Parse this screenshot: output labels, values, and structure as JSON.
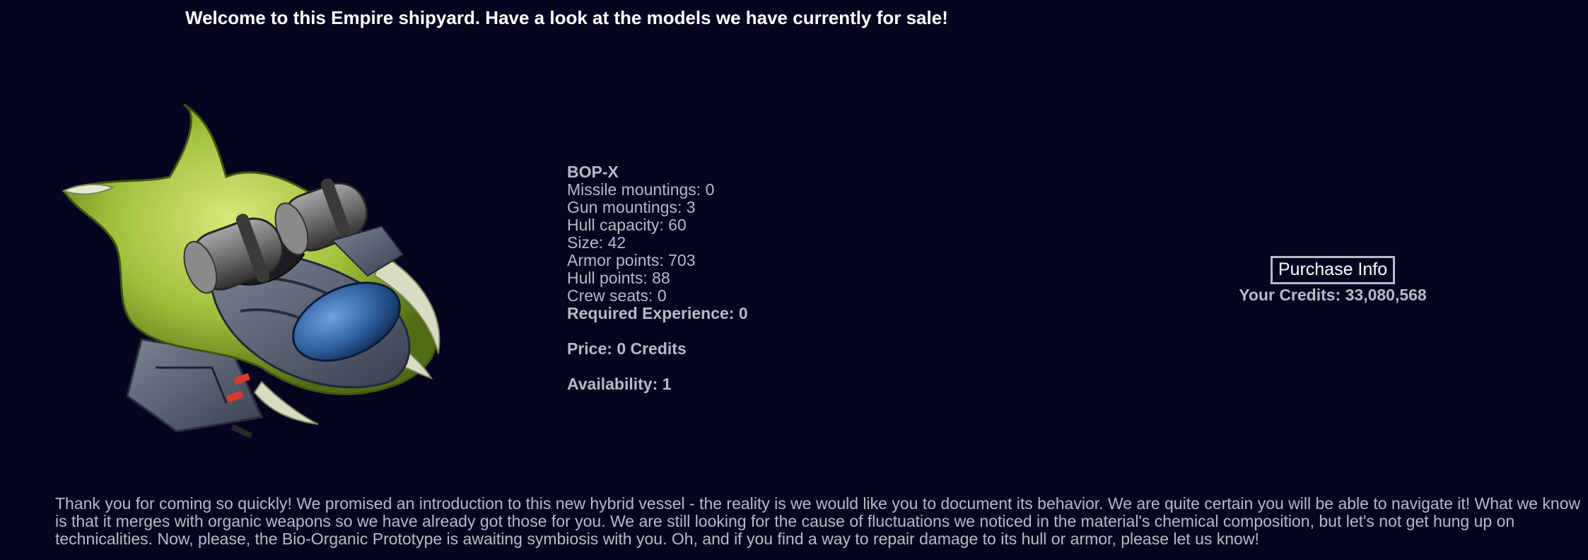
{
  "welcome_text": "Welcome to this Empire shipyard. Have a look at the models we have currently for sale!",
  "ship": {
    "name": "BOP-X",
    "stats": [
      "Missile mountings: 0",
      "Gun mountings: 3",
      "Hull capacity: 60",
      "Size: 42",
      "Armor points: 703",
      "Hull points: 88",
      "Crew seats: 0"
    ],
    "required_experience": "Required Experience: 0",
    "price": "Price: 0 Credits",
    "availability": "Availability: 1"
  },
  "purchase": {
    "button_label": "Purchase Info",
    "credits": "Your Credits: 33,080,568"
  },
  "description": "Thank you for coming so quickly! We promised an introduction to this new hybrid vessel - the reality is we would like you to document its behavior. We are quite certain you will be able to navigate it! What we know is that it merges with organic weapons so we have already got those for you. We are still looking for the cause of fluctuations we noticed in the material's chemical composition, but let's not get hung up on technicalities. Now, please, the Bio-Organic Prototype is awaiting symbiosis with you. Oh, and if you find a way to repair damage to its hull or armor, please let us know!",
  "colors": {
    "background": "#050520",
    "text": "#b9b9c9",
    "heading": "#ffffff",
    "hull_green": "#9fbf3a",
    "engine_gray": "#6e6e6e",
    "cockpit_blue": "#2f5f9f",
    "armor_gray": "#5a6274"
  },
  "icons": {
    "ship": "bio-organic-ship-icon"
  }
}
